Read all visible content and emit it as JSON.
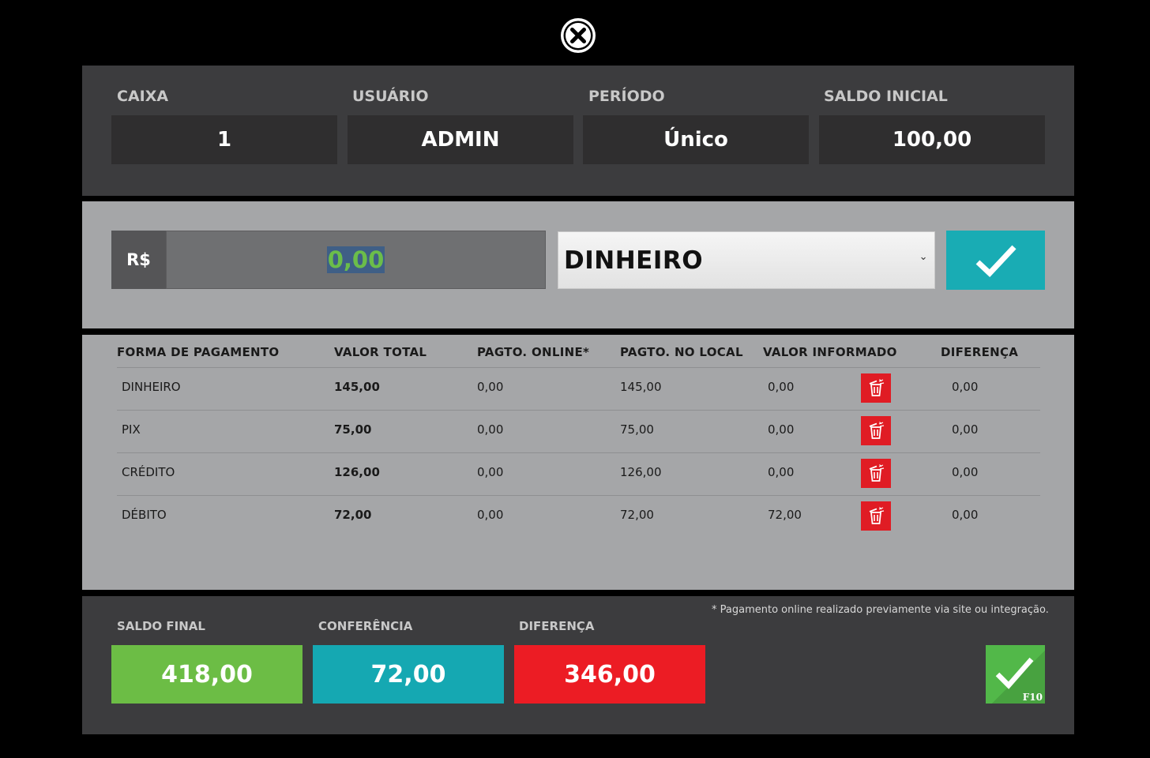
{
  "header": {
    "caixa_label": "CAIXA",
    "caixa_value": "1",
    "usuario_label": "USUÁRIO",
    "usuario_value": "ADMIN",
    "periodo_label": "PERÍODO",
    "periodo_value": "Único",
    "saldo_inicial_label": "SALDO INICIAL",
    "saldo_inicial_value": "100,00"
  },
  "entry": {
    "currency_label": "R$",
    "amount_value": "0,00",
    "payment_method_selected": "DINHEIRO"
  },
  "table": {
    "columns": [
      "FORMA DE PAGAMENTO",
      "VALOR TOTAL",
      "PAGTO. ONLINE*",
      "PAGTO. NO LOCAL",
      "VALOR INFORMADO",
      "DIFERENÇA"
    ],
    "rows": [
      {
        "forma": "DINHEIRO",
        "valor_total": "145,00",
        "online": "0,00",
        "local": "145,00",
        "informado": "0,00",
        "diferenca": "0,00"
      },
      {
        "forma": "PIX",
        "valor_total": "75,00",
        "online": "0,00",
        "local": "75,00",
        "informado": "0,00",
        "diferenca": "0,00"
      },
      {
        "forma": "CRÉDITO",
        "valor_total": "126,00",
        "online": "0,00",
        "local": "126,00",
        "informado": "0,00",
        "diferenca": "0,00"
      },
      {
        "forma": "DÉBITO",
        "valor_total": "72,00",
        "online": "0,00",
        "local": "72,00",
        "informado": "72,00",
        "diferenca": "0,00"
      }
    ]
  },
  "footer": {
    "saldo_final_label": "SALDO FINAL",
    "saldo_final_value": "418,00",
    "conferencia_label": "CONFERÊNCIA",
    "conferencia_value": "72,00",
    "diferenca_label": "DIFERENÇA",
    "diferenca_value": "346,00",
    "note": "* Pagamento online realizado previamente via site ou integração.",
    "finish_shortcut": "F10"
  },
  "colors": {
    "saldo_final": "#6cbd45",
    "conferencia": "#15a8b2",
    "diferenca": "#ec1c24",
    "confirm": "#19acb4",
    "finish": "#52b849"
  },
  "icons": {
    "close": "close-icon",
    "confirm": "check-icon",
    "delete": "trash-icon",
    "finish": "check-icon"
  }
}
